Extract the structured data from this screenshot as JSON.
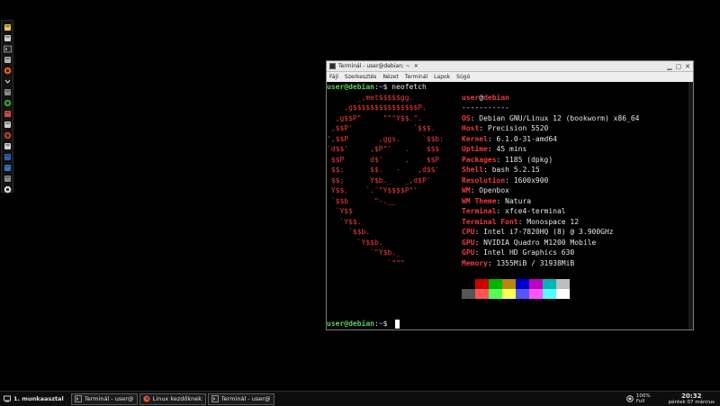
{
  "left_panel": {
    "icons": [
      "user-icon",
      "files-icon",
      "terminal-icon",
      "preferences-icon",
      "firefox-icon",
      "chevron-down-icon",
      "settings-icon",
      "network-icon",
      "mail-icon",
      "archive-icon",
      "help-icon",
      "calendar-icon",
      "screenshot-icon",
      "display-icon",
      "drive-icon",
      "clock-icon"
    ]
  },
  "terminal": {
    "title": "Terminál - user@debian: ~",
    "close_tab_glyph": "✕",
    "menu": [
      "Fájl",
      "Szerkesztés",
      "Nézet",
      "Terminál",
      "Lapok",
      "Súgó"
    ],
    "prompt_user": "user@debian",
    "prompt_sep": ":",
    "prompt_path": "~",
    "prompt_symbol": "$",
    "command": "neofetch",
    "logo_lines": [
      "       _,met$$$$$gg.",
      "    ,g$$$$$$$$$$$$$$$P.",
      "  ,g$$P\"     \"\"\"Y$$.\".",
      " ,$$P'              `$$$.",
      "',$$P       ,ggs.     `$$b:",
      "`d$$'     ,$P\"'   .    $$$",
      " $$P      d$'     ,    $$P",
      " $$:      $$.   -    ,d$$'",
      " $$;      Y$b._   _,d$P'",
      " Y$$.    `.`\"Y$$$$P\"'",
      " `$$b      \"-.__",
      "  `Y$$",
      "   `Y$$.",
      "     `$$b.",
      "       `Y$$b.",
      "          `\"Y$b._",
      "              `\"\"\""
    ],
    "info_header_user": "user",
    "info_header_at": "@",
    "info_header_host": "debian",
    "info_separator": "-----------",
    "info": [
      {
        "key": "OS",
        "value": "Debian GNU/Linux 12 (bookworm) x86_64"
      },
      {
        "key": "Host",
        "value": "Precision 5520"
      },
      {
        "key": "Kernel",
        "value": "6.1.0-31-amd64"
      },
      {
        "key": "Uptime",
        "value": "45 mins"
      },
      {
        "key": "Packages",
        "value": "1185 (dpkg)"
      },
      {
        "key": "Shell",
        "value": "bash 5.2.15"
      },
      {
        "key": "Resolution",
        "value": "1600x900"
      },
      {
        "key": "WM",
        "value": "Openbox"
      },
      {
        "key": "WM Theme",
        "value": "Natura"
      },
      {
        "key": "Terminal",
        "value": "xfce4-terminal"
      },
      {
        "key": "Terminal Font",
        "value": "Monospace 12"
      },
      {
        "key": "CPU",
        "value": "Intel i7-7820HQ (8) @ 3.900GHz"
      },
      {
        "key": "GPU",
        "value": "NVIDIA Quadro M1200 Mobile"
      },
      {
        "key": "GPU",
        "value": "Intel HD Graphics 630"
      },
      {
        "key": "Memory",
        "value": "1355MiB / 31938MiB"
      }
    ],
    "palette_top": [
      "#000000",
      "#cc0000",
      "#00b300",
      "#b8860b",
      "#0000cc",
      "#c000c0",
      "#00b5b5",
      "#bdbdbd"
    ],
    "palette_bottom": [
      "#555555",
      "#ff5555",
      "#55ff55",
      "#ffff55",
      "#5555ff",
      "#ff55ff",
      "#55ffff",
      "#ffffff"
    ]
  },
  "taskbar": {
    "workspace": "1. munkaasztal",
    "tasks": [
      {
        "label": "Terminál - user@...",
        "icon": "terminal-icon"
      },
      {
        "label": "Linux kezdőknek...",
        "icon": "firefox-icon"
      },
      {
        "label": "Terminál - user@...",
        "icon": "terminal-icon"
      }
    ],
    "battery_percent": "100%",
    "battery_status": "Full",
    "clock_time": "20:32",
    "clock_date": "péntek 07 március"
  }
}
